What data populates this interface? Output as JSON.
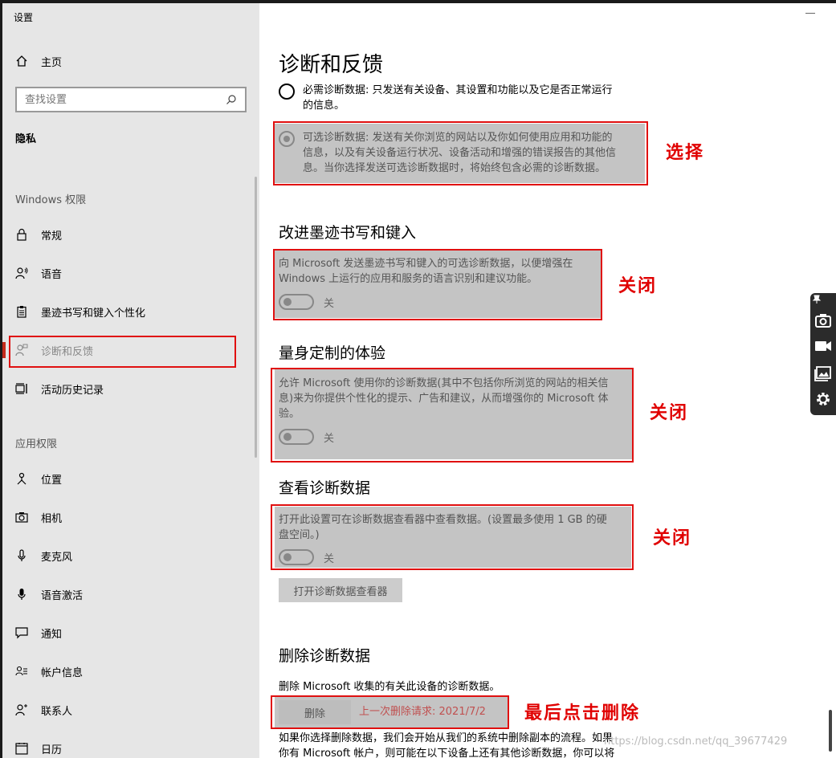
{
  "window": {
    "app_title": "设置"
  },
  "sidebar": {
    "home_label": "主页",
    "search_placeholder": "查找设置",
    "privacy_label": "隐私",
    "windows_permissions_label": "Windows 权限",
    "app_permissions_label": "应用权限",
    "items": [
      {
        "label": "常规",
        "icon": "lock-icon"
      },
      {
        "label": "语音",
        "icon": "speech-icon"
      },
      {
        "label": "墨迹书写和键入个性化",
        "icon": "clipboard-icon"
      },
      {
        "label": "诊断和反馈",
        "icon": "feedback-icon",
        "active": true
      },
      {
        "label": "活动历史记录",
        "icon": "timeline-icon"
      }
    ],
    "app_items": [
      {
        "label": "位置",
        "icon": "location-icon"
      },
      {
        "label": "相机",
        "icon": "camera-icon"
      },
      {
        "label": "麦克风",
        "icon": "microphone-icon"
      },
      {
        "label": "语音激活",
        "icon": "voice-activation-icon"
      },
      {
        "label": "通知",
        "icon": "notification-icon"
      },
      {
        "label": "帐户信息",
        "icon": "account-info-icon"
      },
      {
        "label": "联系人",
        "icon": "contacts-icon"
      },
      {
        "label": "日历",
        "icon": "calendar-icon"
      }
    ]
  },
  "main": {
    "title": "诊断和反馈",
    "required_option": {
      "line1": "必需诊断数据: 只发送有关设备、其设置和功能以及它是否正常运行",
      "line2": "的信息。"
    },
    "optional_option": {
      "line1": "可选诊断数据: 发送有关你浏览的网站以及你如何使用应用和功能的",
      "line2": "信息，以及有关设备运行状况、设备活动和增强的错误报告的其他信",
      "line3": "息。当你选择发送可选诊断数据时，将始终包含必需的诊断数据。"
    },
    "inking": {
      "heading": "改进墨迹书写和键入",
      "line1": "向 Microsoft 发送墨迹书写和键入的可选诊断数据，以便增强在",
      "line2": "Windows 上运行的应用和服务的语言识别和建议功能。",
      "toggle_label": "关"
    },
    "tailored": {
      "heading": "量身定制的体验",
      "line1": "允许 Microsoft 使用你的诊断数据(其中不包括你所浏览的网站的相关信",
      "line2": "息)来为你提供个性化的提示、广告和建议，从而增强你的 Microsoft 体",
      "line3": "验。",
      "toggle_label": "关"
    },
    "view_data": {
      "heading": "查看诊断数据",
      "line1": "打开此设置可在诊断数据查看器中查看数据。(设置最多使用 1 GB 的硬",
      "line2": "盘空间。)",
      "toggle_label": "关",
      "open_viewer_button": "打开诊断数据查看器"
    },
    "delete_data": {
      "heading": "删除诊断数据",
      "description": "删除 Microsoft 收集的有关此设备的诊断数据。",
      "delete_button": "删除",
      "last_request": "上一次删除请求: 2021/7/2",
      "footer_line1": "如果你选择删除数据，我们会开始从我们的系统中删除副本的流程。如果",
      "footer_line2": "你有 Microsoft 帐户，则可能在以下设备上还有其他诊断数据，你可以将"
    }
  },
  "annotations": {
    "select": "选择",
    "close1": "关闭",
    "close2": "关闭",
    "close3": "关闭",
    "final_delete": "最后点击删除"
  },
  "watermark": "https://blog.csdn.net/qq_39677429",
  "colors": {
    "annotation_red": "#e01010",
    "sidebar_bg": "#e6e6e6",
    "panel_grey": "#c4c4c4"
  }
}
